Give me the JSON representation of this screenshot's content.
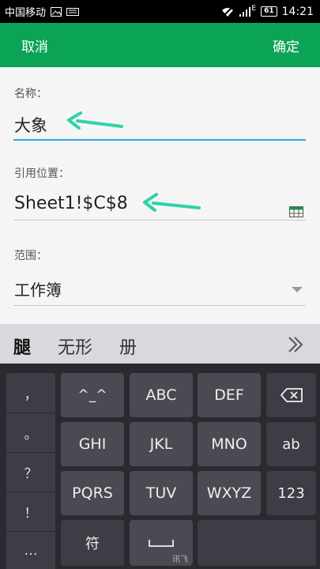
{
  "status_bar": {
    "carrier": "中国移动",
    "signal": "E",
    "battery": "61",
    "time": "14:21"
  },
  "header": {
    "cancel_label": "取消",
    "confirm_label": "确定",
    "background": "#0ba454"
  },
  "form": {
    "name_label": "名称：",
    "name_value": "大象",
    "ref_label": "引用位置：",
    "ref_value": "Sheet1!$C$8",
    "scope_label": "范围：",
    "scope_value": "工作簿",
    "accent": "#29a9d8"
  },
  "keyboard": {
    "candidates": [
      "腿",
      "无形",
      "册"
    ],
    "side_keys": [
      "，",
      "。",
      "？",
      "！",
      "…"
    ],
    "keys": {
      "row1": [
        "^_^",
        "ABC",
        "DEF"
      ],
      "row2": [
        "GHI",
        "JKL",
        "MNO",
        "ab"
      ],
      "row3": [
        "PQRS",
        "TUV",
        "WXYZ",
        "123"
      ],
      "symbol": "符"
    },
    "brand": "讯飞"
  }
}
